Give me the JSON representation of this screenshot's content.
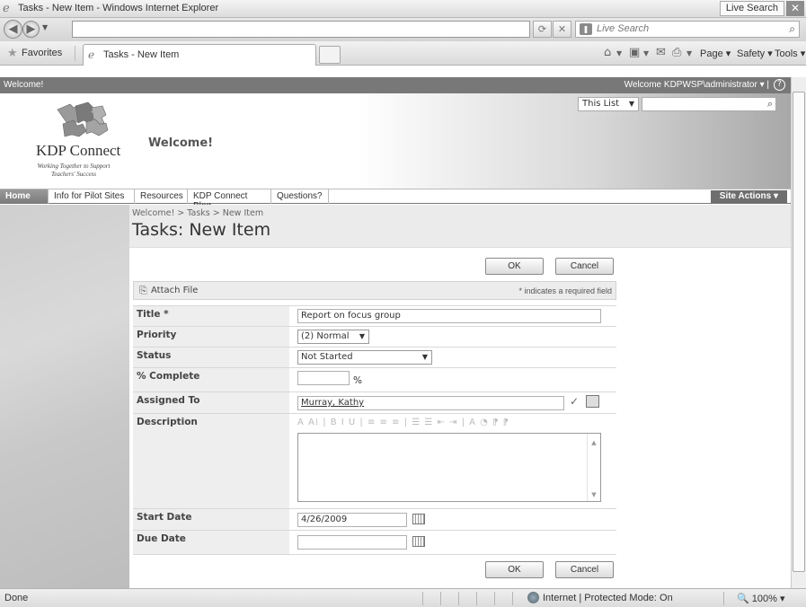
{
  "browser": {
    "window_title": "Tasks - New Item - Windows Internet Explorer",
    "live_search_tab": "Live Search",
    "close": "✕",
    "search_placeholder": "Live Search",
    "favorites": "Favorites",
    "tab_title": "Tasks - New Item",
    "commands": {
      "page": "Page ▾",
      "safety": "Safety ▾",
      "tools": "Tools ▾"
    }
  },
  "site": {
    "welcome_left": "Welcome!",
    "welcome_user": "Welcome KDPWSP\\administrator ▾ |",
    "help": "?",
    "name": "KDP Connect",
    "tagline": "Working Together to Support Teachers' Success",
    "title": "Welcome!",
    "search_scope": "This List",
    "nav": [
      "Home",
      "Info for Pilot Sites",
      "Resources",
      "KDP Connect Blog",
      "Questions?"
    ],
    "site_actions": "Site Actions ▾"
  },
  "page": {
    "breadcrumb": "Welcome! > Tasks > New Item",
    "title": "Tasks: New Item",
    "ok_label": "OK",
    "cancel_label": "Cancel",
    "attach_file": "Attach File",
    "required_note": "* indicates a required field"
  },
  "form": {
    "title_label": "Title *",
    "title_value": "Report on focus group",
    "priority_label": "Priority",
    "priority_value": "(2) Normal",
    "status_label": "Status",
    "status_value": "Not Started",
    "pct_label": "% Complete",
    "pct_value": "",
    "pct_suffix": "%",
    "assigned_label": "Assigned To",
    "assigned_value": "Murray, Kathy",
    "description_label": "Description",
    "rte_toolbar": "A A⁞ | B I U | ≡ ≡ ≡ | ☰ ☰ ⇤ ⇥ | A ◔ ⁋ ⁋",
    "start_label": "Start Date",
    "start_value": "4/26/2009",
    "due_label": "Due Date",
    "due_value": ""
  },
  "status": {
    "text": "Done",
    "zone": "Internet | Protected Mode: On",
    "zoom": "🔍 100% ▾"
  },
  "colors": {
    "welcome_bar": "#787878",
    "nav_active": "#8a8a8a",
    "site_actions": "#6e6e6e"
  }
}
